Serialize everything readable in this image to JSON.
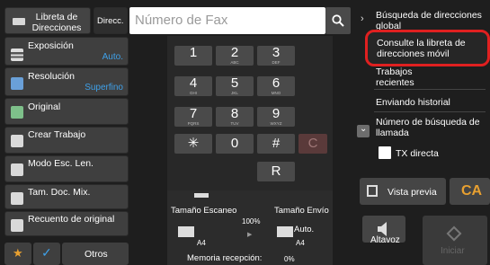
{
  "top": {
    "address_book": "Libreta de Direcciones",
    "direct": "Direcc.",
    "fax_placeholder": "Número de Fax"
  },
  "left": {
    "exposure_label": "Exposición",
    "exposure_value": "Auto.",
    "resolution_label": "Resolución",
    "resolution_value": "Superfino",
    "original": "Original",
    "create_job": "Crear Trabajo",
    "slow_scan": "Modo Esc. Len.",
    "mixed_size": "Tam. Doc. Mix.",
    "original_count": "Recuento de original",
    "others": "Otros"
  },
  "keypad": {
    "keys": [
      {
        "n": "1",
        "s": ""
      },
      {
        "n": "2",
        "s": "ABC"
      },
      {
        "n": "3",
        "s": "DEF"
      },
      {
        "n": "4",
        "s": "GHI"
      },
      {
        "n": "5",
        "s": "JKL"
      },
      {
        "n": "6",
        "s": "MNO"
      },
      {
        "n": "7",
        "s": "PQRS"
      },
      {
        "n": "8",
        "s": "TUV"
      },
      {
        "n": "9",
        "s": "WXYZ"
      },
      {
        "n": "✳",
        "s": ""
      },
      {
        "n": "0",
        "s": ""
      },
      {
        "n": "#",
        "s": ""
      }
    ],
    "clear": "C",
    "redial": "R"
  },
  "bottom": {
    "scan_size_label": "Tamaño Escaneo",
    "scan_size_value": "A4",
    "ratio": "100%",
    "send_size_label": "Tamaño Envío",
    "send_size_auto": "Auto.",
    "send_size_value": "A4",
    "memory_label": "Memoria recepción:",
    "memory_value": "0%"
  },
  "right": {
    "global_search": "Búsqueda de direcciones global",
    "mobile_book": "Consulte la libreta de direcciones móvil",
    "recent_jobs": "Trabajos recientes",
    "sending_history": "Enviando historial",
    "number_search": "Número de búsqueda de llamada",
    "direct_tx": "TX directa",
    "preview": "Vista previa",
    "ca": "CA",
    "speaker": "Altavoz",
    "start": "Iniciar"
  },
  "colors": {
    "accent_blue": "#3fa0e8",
    "ca_orange": "#e8a030",
    "highlight_red": "#e02020"
  }
}
